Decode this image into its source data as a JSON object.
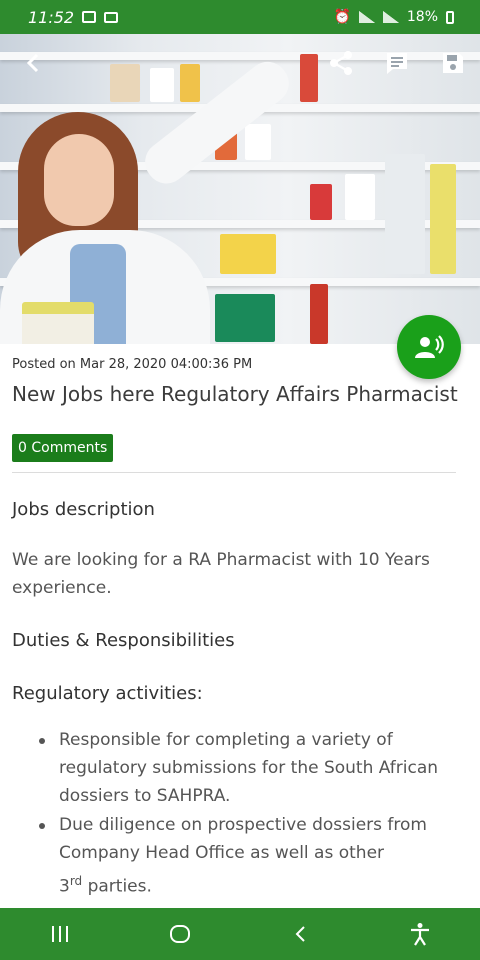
{
  "status_bar": {
    "time": "11:52",
    "battery": "18%",
    "icons": [
      "message-icon",
      "screen-icon",
      "alarm-icon",
      "signal-icon",
      "signal-icon",
      "battery-icon"
    ]
  },
  "toolbar": {
    "back_icon": "chevron-left-icon",
    "share_icon": "share-icon",
    "comment_icon": "comment-icon",
    "save_icon": "save-icon"
  },
  "fab": {
    "icon": "voice-icon",
    "color": "#1aa01a"
  },
  "post": {
    "posted_on": "Posted on Mar 28, 2020 04:00:36 PM",
    "title": "New Jobs here Regulatory Affairs Pharmacist",
    "comments_label": "0 Comments"
  },
  "article": {
    "description_heading": "Jobs description",
    "description_text": "We are looking for a RA Pharmacist with 10 Years experience.",
    "duties_heading": "Duties & Responsibilities",
    "regulatory_heading": "Regulatory activities:",
    "bullets": [
      "Responsible for completing a variety of regulatory submissions for the South African dossiers to SAHPRA.",
      "Due diligence on prospective dossiers from Company Head Office as well as other"
    ],
    "bullet2_tail_pre": "3",
    "bullet2_tail_sup": "rd",
    "bullet2_tail_post": " parties."
  },
  "nav_bar": {
    "icons": [
      "recent-apps-icon",
      "home-icon",
      "back-icon",
      "accessibility-icon"
    ]
  },
  "colors": {
    "brand_green": "#2e8b2e",
    "badge_green": "#1b7d1b"
  }
}
